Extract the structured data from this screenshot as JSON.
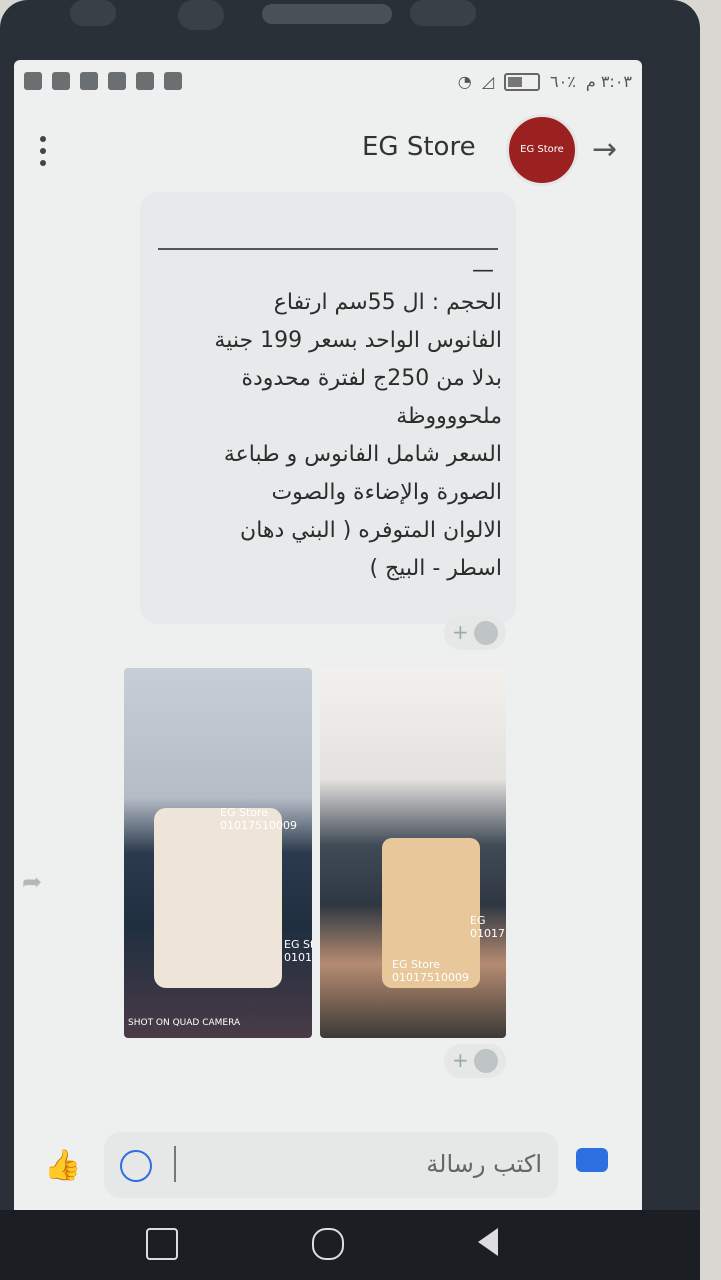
{
  "status": {
    "time": "٣:٠٣ م",
    "battery": "٦٠٪"
  },
  "header": {
    "title": "EG Store",
    "avatar_text": "EG Store",
    "back_icon": "arrow-back-icon",
    "menu_icon": "more-vert-icon"
  },
  "message": {
    "dash": "—",
    "text": "الحجم : ال 55سم ارتفاع\nالفانوس الواحد بسعر 199 جنية\nبدلا من 250ج لفترة محدودة\nملحووووظة\nالسعر شامل الفانوس و طباعة\nالصورة والإضاءة والصوت\nالالوان المتوفره ( البني دهان\nاسطر - البيج )"
  },
  "images": {
    "img1_wm": "EG Store\n01017510009",
    "img2_wm": "EG Store\n01017510009",
    "img1_wm2": "EG St\n0101751",
    "img2_wm2": "EG\n01017",
    "img1_camera": "SHOT ON QUAD CAMERA"
  },
  "composer": {
    "placeholder": "اكتب رسالة"
  },
  "colors": {
    "accent": "#2d6fe0",
    "bubble": "#e7eaea"
  }
}
